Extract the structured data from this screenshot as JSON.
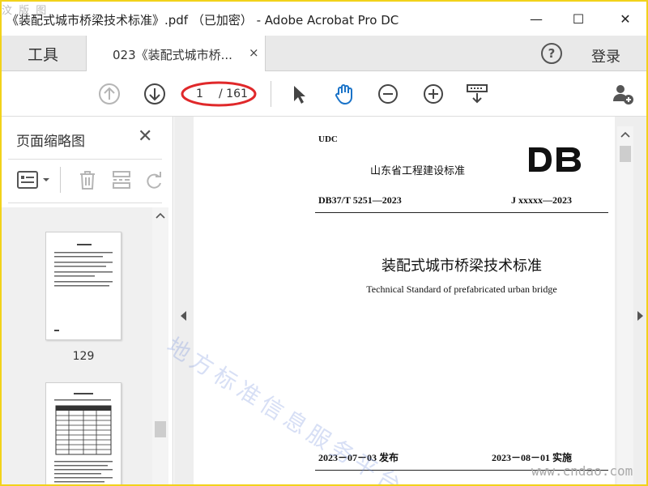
{
  "window": {
    "title": "《装配式城市桥梁技术标准》.pdf （已加密） - Adobe Acrobat Pro DC",
    "corner_watermark": "汶 版 图",
    "controls": {
      "minimize": "—",
      "maximize": "☐",
      "close": "✕"
    }
  },
  "tabs": {
    "tools_label": "工具",
    "document_label": "023《装配式城市桥...",
    "close_glyph": "×",
    "help_glyph": "?",
    "login_label": "登录"
  },
  "toolbar": {
    "current_page": "1",
    "total_pages": "/ 161",
    "icons": [
      "prev-page-icon",
      "next-page-icon",
      "select-arrow-icon",
      "hand-tool-icon",
      "zoom-out-icon",
      "zoom-in-icon",
      "scroll-mode-icon",
      "add-user-icon"
    ],
    "accent": "#1a73c8",
    "annotation_color": "#e0282a"
  },
  "left_panel": {
    "title": "页面缩略图",
    "close_glyph": "✕",
    "thumbnails": [
      {
        "label": "129"
      }
    ]
  },
  "document": {
    "udc": "UDC",
    "issuer": "山东省工程建设标准",
    "logo": "DB",
    "code_left": "DB37/T 5251—2023",
    "code_right": "J xxxxx—2023",
    "title_cn": "装配式城市桥梁技术标准",
    "title_en": "Technical Standard of prefabricated urban bridge",
    "date_left": "2023－07－03 发布",
    "date_right": "2023－08－01 实施"
  },
  "watermarks": {
    "diagonal": "地方标准信息服务平台",
    "url": "www.cndao.com"
  }
}
